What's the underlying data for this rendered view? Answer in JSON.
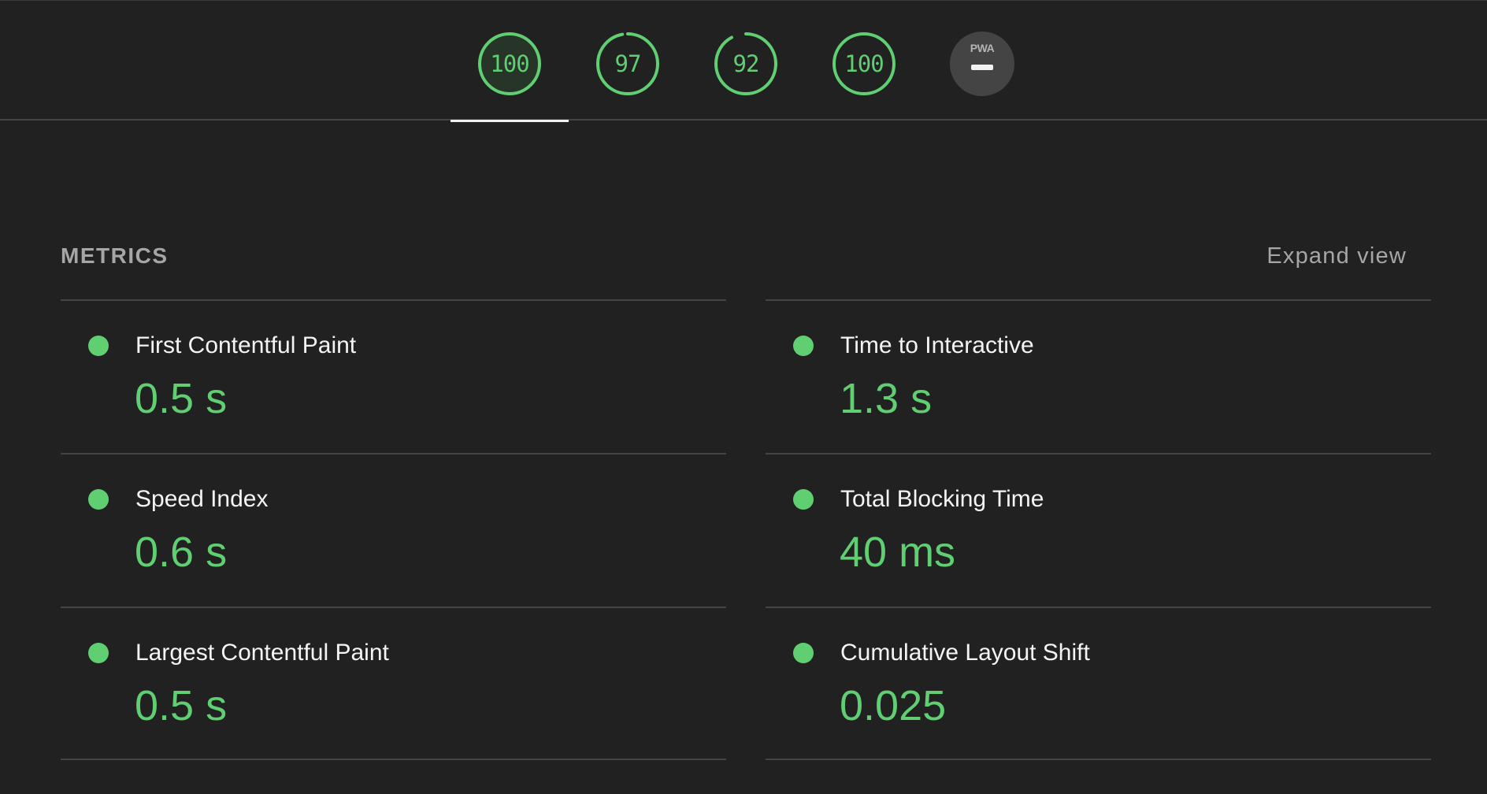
{
  "gauges": [
    {
      "score": "100",
      "fraction": 1.0,
      "active": true
    },
    {
      "score": "97",
      "fraction": 0.97,
      "active": false
    },
    {
      "score": "92",
      "fraction": 0.92,
      "active": false
    },
    {
      "score": "100",
      "fraction": 1.0,
      "active": false
    }
  ],
  "pwa": {
    "label": "PWA"
  },
  "colors": {
    "pass": "#5fcf72",
    "background": "#212121",
    "divider": "#444444",
    "muted_text": "#a6a6a6"
  },
  "metrics": {
    "title": "METRICS",
    "expand_label": "Expand view",
    "items": [
      {
        "label": "First Contentful Paint",
        "value": "0.5 s",
        "status": "pass"
      },
      {
        "label": "Time to Interactive",
        "value": "1.3 s",
        "status": "pass"
      },
      {
        "label": "Speed Index",
        "value": "0.6 s",
        "status": "pass"
      },
      {
        "label": "Total Blocking Time",
        "value": "40 ms",
        "status": "pass"
      },
      {
        "label": "Largest Contentful Paint",
        "value": "0.5 s",
        "status": "pass"
      },
      {
        "label": "Cumulative Layout Shift",
        "value": "0.025",
        "status": "pass"
      }
    ]
  }
}
